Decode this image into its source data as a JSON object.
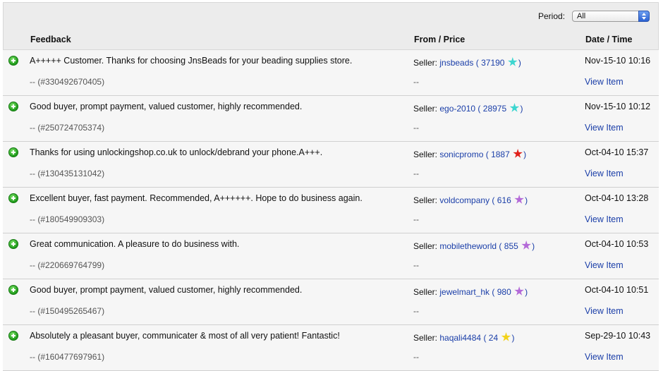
{
  "period": {
    "label": "Period:",
    "selected": "All"
  },
  "header": {
    "feedback": "Feedback",
    "from_price": "From / Price",
    "date_time": "Date / Time"
  },
  "rows": [
    {
      "text": "A+++++ Customer. Thanks for choosing JnsBeads for your beading supplies store.",
      "id": "-- (#330492670405)",
      "role": "Seller:",
      "user": "jnsbeads",
      "open": "(",
      "score": "37190",
      "close": ")",
      "star_color": "#3dd6d0",
      "price": "--",
      "date": "Nov-15-10 10:16",
      "view": "View Item"
    },
    {
      "text": "Good buyer, prompt payment, valued customer, highly recommended.",
      "id": "-- (#250724705374)",
      "role": "Seller:",
      "user": "ego-2010",
      "open": "(",
      "score": "28975",
      "close": ")",
      "star_color": "#3dd6d0",
      "price": "--",
      "date": "Nov-15-10 10:12",
      "view": "View Item"
    },
    {
      "text": "Thanks for using unlockingshop.co.uk to unlock/debrand your phone.A+++.",
      "id": "-- (#130435131042)",
      "role": "Seller:",
      "user": "sonicpromo",
      "open": "(",
      "score": "1887",
      "close": ")",
      "star_color": "#e0201a",
      "price": "--",
      "date": "Oct-04-10 15:37",
      "view": "View Item"
    },
    {
      "text": "Excellent buyer, fast payment. Recommended, A++++++. Hope to do business again.",
      "id": "-- (#180549909303)",
      "role": "Seller:",
      "user": "voldcompany",
      "open": "(",
      "score": "616",
      "close": ")",
      "star_color": "#b46ad8",
      "price": "--",
      "date": "Oct-04-10 13:28",
      "view": "View Item"
    },
    {
      "text": "Great communication. A pleasure to do business with.",
      "id": "-- (#220669764799)",
      "role": "Seller:",
      "user": "mobiletheworld",
      "open": "(",
      "score": "855",
      "close": ")",
      "star_color": "#b46ad8",
      "price": "--",
      "date": "Oct-04-10 10:53",
      "view": "View Item"
    },
    {
      "text": "Good buyer, prompt payment, valued customer, highly recommended.",
      "id": "-- (#150495265467)",
      "role": "Seller:",
      "user": "jewelmart_hk",
      "open": "(",
      "score": "980",
      "close": ")",
      "star_color": "#b46ad8",
      "price": "--",
      "date": "Oct-04-10 10:51",
      "view": "View Item"
    },
    {
      "text": "Absolutely a pleasant buyer, communicater & most of all very patient! Fantastic!",
      "id": "-- (#160477697961)",
      "role": "Seller:",
      "user": "haqali4484",
      "open": "(",
      "score": "24",
      "close": ")",
      "star_color": "#f2d21a",
      "price": "--",
      "date": "Sep-29-10 10:43",
      "view": "View Item"
    }
  ]
}
